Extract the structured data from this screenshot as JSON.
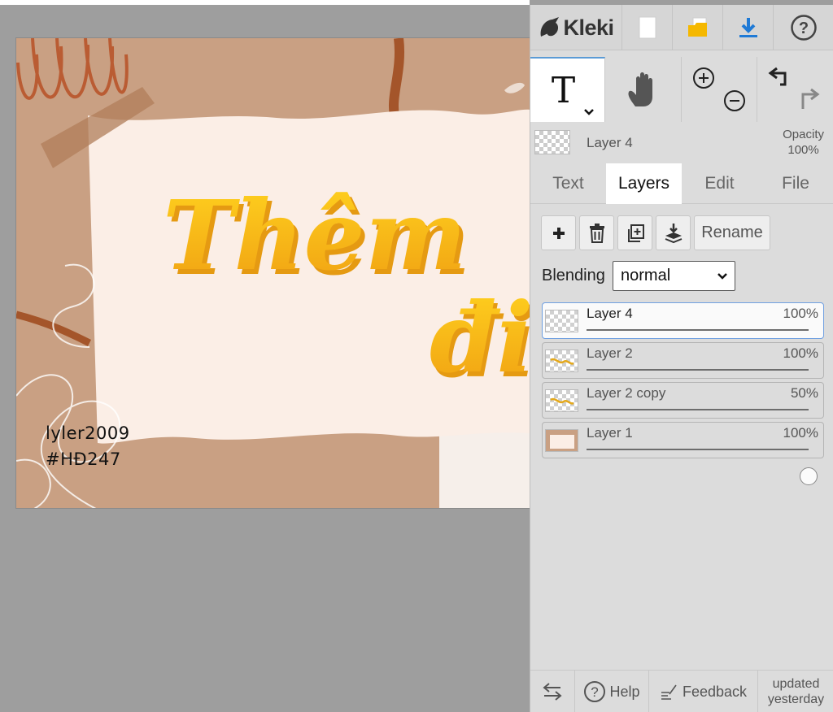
{
  "app": {
    "name": "Kleki"
  },
  "canvas": {
    "headline": "Thêm",
    "headline_partial": "đi",
    "signature_line1": "lyler2009",
    "signature_line2": "#HĐ247"
  },
  "toolbar": {
    "icons": [
      "new-image-icon",
      "open-folder-icon",
      "download-icon",
      "help-icon"
    ]
  },
  "tools": {
    "text_tool_glyph": "T",
    "active_tool": "text"
  },
  "current_layer": {
    "name": "Layer 4",
    "opacity_label": "Opacity",
    "opacity_value": "100%"
  },
  "tabs": [
    {
      "label": "Text",
      "active": false
    },
    {
      "label": "Layers",
      "active": true
    },
    {
      "label": "Edit",
      "active": false
    },
    {
      "label": "File",
      "active": false
    }
  ],
  "layer_actions": {
    "rename_label": "Rename"
  },
  "blending": {
    "label": "Blending",
    "value": "normal"
  },
  "layers": [
    {
      "name": "Layer 4",
      "opacity_text": "100%",
      "opacity": 1.0,
      "selected": true
    },
    {
      "name": "Layer 2",
      "opacity_text": "100%",
      "opacity": 1.0,
      "selected": false
    },
    {
      "name": "Layer 2 copy",
      "opacity_text": "50%",
      "opacity": 0.5,
      "selected": false
    },
    {
      "name": "Layer 1",
      "opacity_text": "100%",
      "opacity": 1.0,
      "selected": false
    }
  ],
  "bottom": {
    "help_label": "Help",
    "feedback_label": "Feedback",
    "updated_line1": "updated",
    "updated_line2": "yesterday"
  },
  "colors": {
    "accent": "#5b9bd5",
    "headline_yellow": "#f5b50f",
    "canvas_bg": "#c9a083",
    "paper": "#fbeee6"
  }
}
